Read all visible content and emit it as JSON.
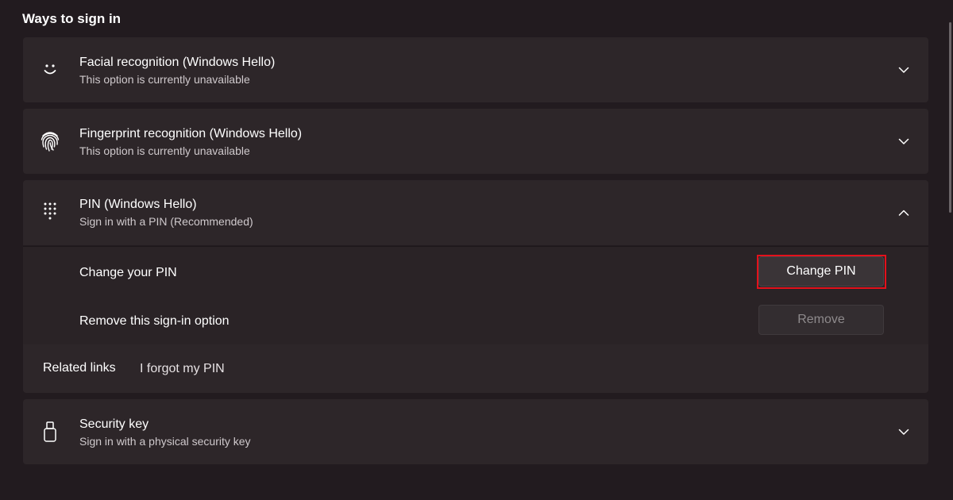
{
  "section": {
    "title": "Ways to sign in"
  },
  "options": [
    {
      "title": "Facial recognition (Windows Hello)",
      "subtitle": "This option is currently unavailable",
      "icon": "smiley-face-icon",
      "expanded": false
    },
    {
      "title": "Fingerprint recognition (Windows Hello)",
      "subtitle": "This option is currently unavailable",
      "icon": "fingerprint-icon",
      "expanded": false
    },
    {
      "title": "PIN (Windows Hello)",
      "subtitle": "Sign in with a PIN (Recommended)",
      "icon": "keypad-icon",
      "expanded": true
    },
    {
      "title": "Security key",
      "subtitle": "Sign in with a physical security key",
      "icon": "usb-key-icon",
      "expanded": false
    }
  ],
  "pin": {
    "change_label": "Change your PIN",
    "change_button": "Change PIN",
    "remove_label": "Remove this sign-in option",
    "remove_button": "Remove",
    "related_links_label": "Related links",
    "forgot_link": "I forgot my PIN"
  },
  "colors": {
    "background": "#221b1f",
    "card": "#2d2629",
    "highlight": "#e4111b"
  }
}
